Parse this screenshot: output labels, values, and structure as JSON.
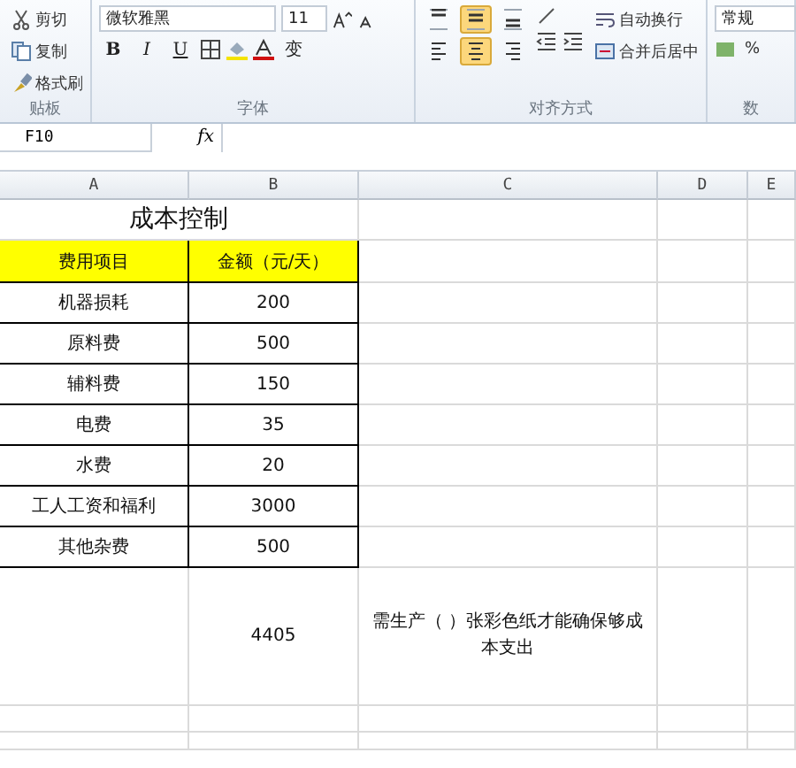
{
  "ribbon": {
    "clipboard": {
      "label": "贴板",
      "items": [
        {
          "label": "剪切",
          "kind": "cut"
        },
        {
          "label": "复制",
          "kind": "copy"
        },
        {
          "label": "格式刷",
          "kind": "brush"
        }
      ]
    },
    "font": {
      "label": "字体",
      "font_name": "微软雅黑",
      "font_size": "11",
      "bold": "B",
      "italic": "I",
      "underline": "U",
      "wen": "变"
    },
    "alignment": {
      "label": "对齐方式",
      "vertical": [
        {
          "kind": "top",
          "selected": false
        },
        {
          "kind": "middle",
          "selected": true
        },
        {
          "kind": "bottom",
          "selected": false
        }
      ],
      "horizontal": [
        {
          "kind": "left",
          "selected": false
        },
        {
          "kind": "center",
          "selected": true
        },
        {
          "kind": "right",
          "selected": false
        }
      ],
      "wrap_text": "自动换行",
      "merge_center": "合并后居中"
    },
    "number": {
      "label": "数",
      "format": "常规",
      "percent": "%"
    }
  },
  "formula_bar": {
    "name_box": "F10",
    "fx": "fx"
  },
  "columns": [
    "A",
    "B",
    "C",
    "D",
    "E"
  ],
  "sheet": {
    "title": "成本控制",
    "header": [
      "费用项目",
      "金额（元/天）"
    ],
    "rows": [
      {
        "item": "机器损耗",
        "amount": "200"
      },
      {
        "item": "原料费",
        "amount": "500"
      },
      {
        "item": "辅料费",
        "amount": "150"
      },
      {
        "item": "电费",
        "amount": "35"
      },
      {
        "item": "水费",
        "amount": "20"
      },
      {
        "item": "工人工资和福利",
        "amount": "3000"
      },
      {
        "item": "其他杂费",
        "amount": "500"
      }
    ],
    "total": "4405",
    "note": "需生产（ ）张彩色纸才能确保够成本支出"
  }
}
